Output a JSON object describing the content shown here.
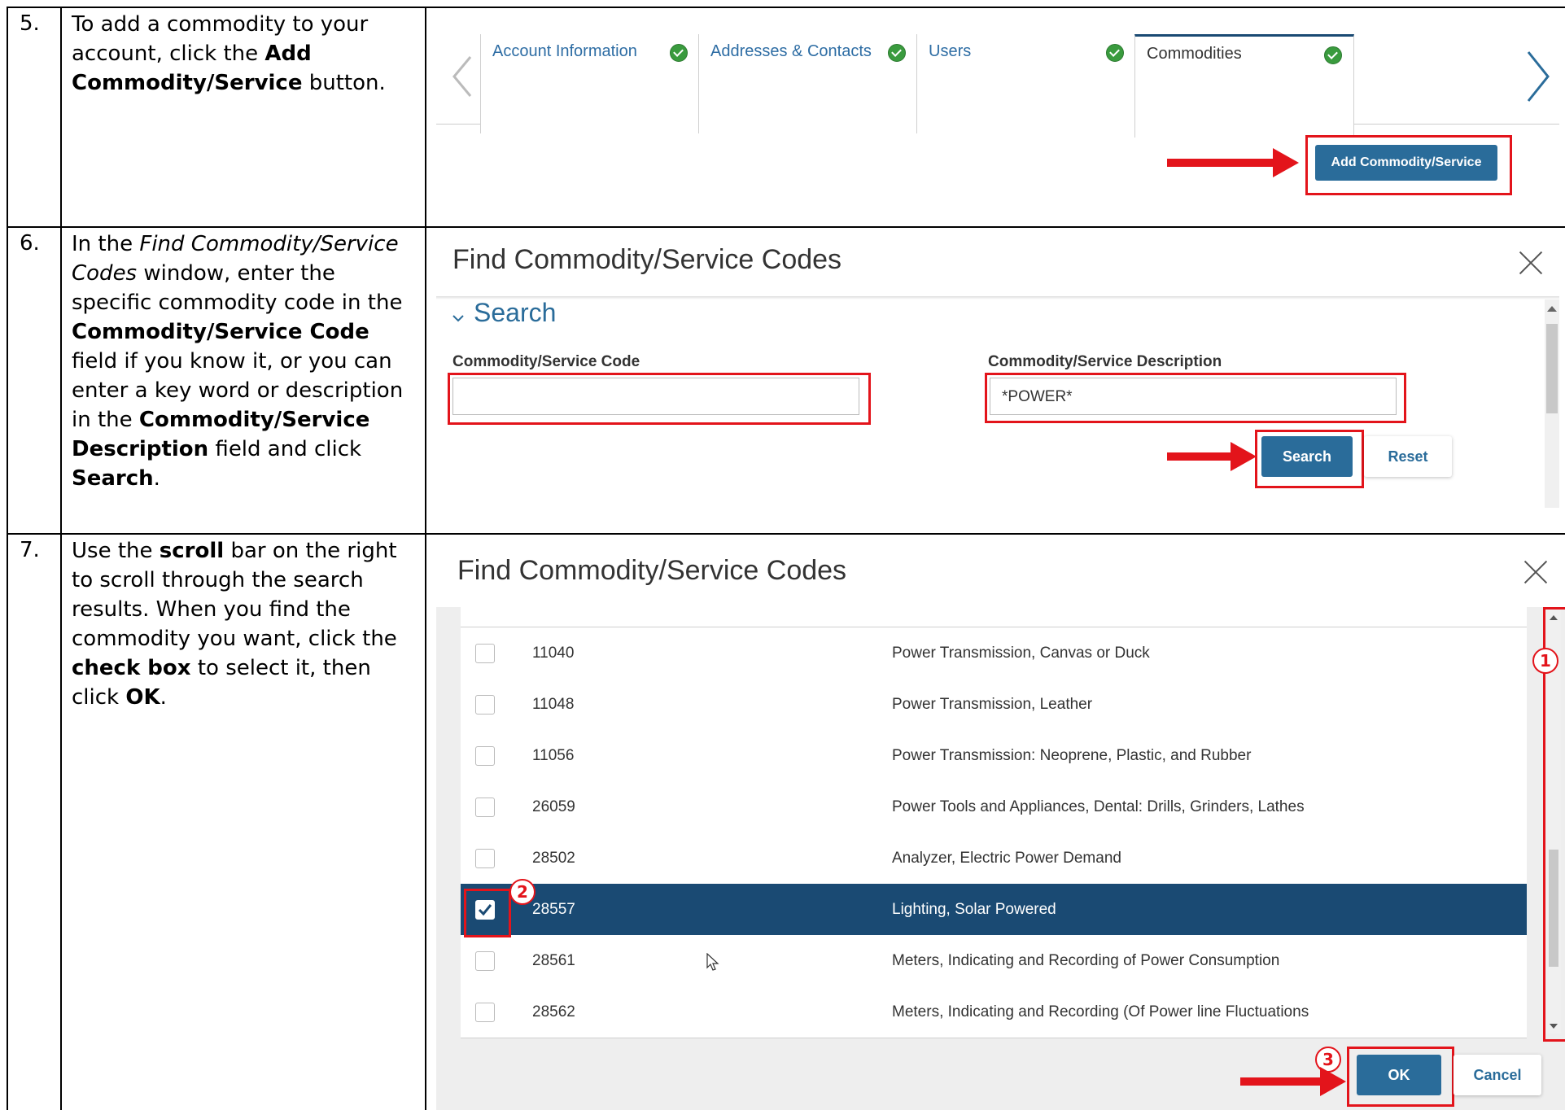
{
  "steps": [
    {
      "number": "5.",
      "text_parts": [
        "To add a commodity to your account, click the ",
        "Add Commodity/Service",
        " button."
      ]
    },
    {
      "number": "6.",
      "text_parts": [
        "In the ",
        "Find Commodity/Service Codes",
        " window, enter the specific commodity code in the ",
        "Commodity/Service Code",
        " field if you know it, or you can enter a key word or description in the ",
        "Commodity/Service Description",
        " field and click ",
        "Search",
        "."
      ]
    },
    {
      "number": "7.",
      "text_parts": [
        "Use the ",
        "scroll",
        " bar on the right to scroll through the search results. When you find the commodity you want, click the ",
        "check box",
        " to select it, then click ",
        "OK",
        "."
      ]
    }
  ],
  "tabs": [
    {
      "label": "Account Information",
      "complete": true
    },
    {
      "label": "Addresses & Contacts",
      "complete": true
    },
    {
      "label": "Users",
      "complete": true
    },
    {
      "label": "Commodities",
      "complete": true,
      "active": true
    }
  ],
  "add_button_label": "Add Commodity/Service",
  "search_dialog": {
    "title": "Find Commodity/Service Codes",
    "section_label": "Search",
    "code_label": "Commodity/Service Code",
    "code_value": "",
    "desc_label": "Commodity/Service Description",
    "desc_value": "*POWER*",
    "search_button": "Search",
    "reset_button": "Reset"
  },
  "results_dialog": {
    "title": "Find Commodity/Service Codes",
    "rows": [
      {
        "code": "11040",
        "description": "Power Transmission, Canvas or Duck",
        "checked": false
      },
      {
        "code": "11048",
        "description": "Power Transmission, Leather",
        "checked": false
      },
      {
        "code": "11056",
        "description": "Power Transmission: Neoprene, Plastic, and Rubber",
        "checked": false
      },
      {
        "code": "26059",
        "description": "Power Tools and Appliances, Dental: Drills, Grinders, Lathes",
        "checked": false
      },
      {
        "code": "28502",
        "description": "Analyzer, Electric Power Demand",
        "checked": false
      },
      {
        "code": "28557",
        "description": "Lighting, Solar Powered",
        "checked": true
      },
      {
        "code": "28561",
        "description": "Meters, Indicating and Recording of Power Consumption",
        "checked": false
      },
      {
        "code": "28562",
        "description": "Meters, Indicating and Recording (Of Power line Fluctuations",
        "checked": false
      }
    ],
    "ok_button": "OK",
    "cancel_button": "Cancel",
    "callouts": [
      "1",
      "2",
      "3"
    ]
  },
  "colors": {
    "primary_button": "#2a6c9a",
    "selected_row": "#1a4a73",
    "highlight_red": "#e3141b",
    "tab_check": "#3a9b3e"
  }
}
